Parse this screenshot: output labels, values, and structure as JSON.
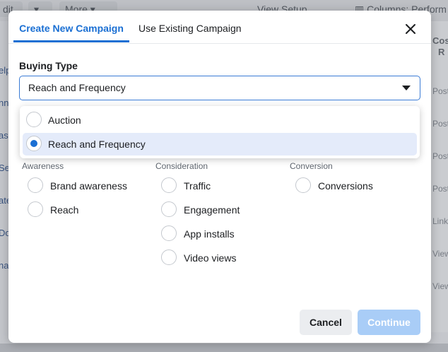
{
  "background": {
    "topbar": {
      "btn1": "dit",
      "more": "More",
      "view_setup": "View Setup",
      "columns": "Columns: Perform"
    },
    "left_fragments": [
      "elp",
      "nn",
      "as",
      "Se",
      "ate",
      "Do",
      "na",
      "i"
    ],
    "right_header": [
      "Cos",
      "R"
    ],
    "right_fragments": [
      "Post",
      "Post",
      "Post",
      "Post",
      "Link",
      "View",
      "View"
    ]
  },
  "modal": {
    "tabs": [
      {
        "label": "Create New Campaign",
        "active": true
      },
      {
        "label": "Use Existing Campaign",
        "active": false
      }
    ],
    "close_icon": "close-icon",
    "buying_type": {
      "label": "Buying Type",
      "value": "Reach and Frequency",
      "options": [
        {
          "label": "Auction",
          "selected": false
        },
        {
          "label": "Reach and Frequency",
          "selected": true
        }
      ]
    },
    "objectives": {
      "awareness": {
        "label": "Awareness",
        "items": [
          "Brand awareness",
          "Reach"
        ]
      },
      "consideration": {
        "label": "Consideration",
        "items": [
          "Traffic",
          "Engagement",
          "App installs",
          "Video views"
        ]
      },
      "conversion": {
        "label": "Conversion",
        "items": [
          "Conversions"
        ]
      }
    },
    "buttons": {
      "cancel": "Cancel",
      "continue": "Continue"
    }
  },
  "colors": {
    "accent": "#1a6fd3",
    "continue_disabled": "#a9cdf7",
    "option_highlight": "#e4ebfa"
  }
}
